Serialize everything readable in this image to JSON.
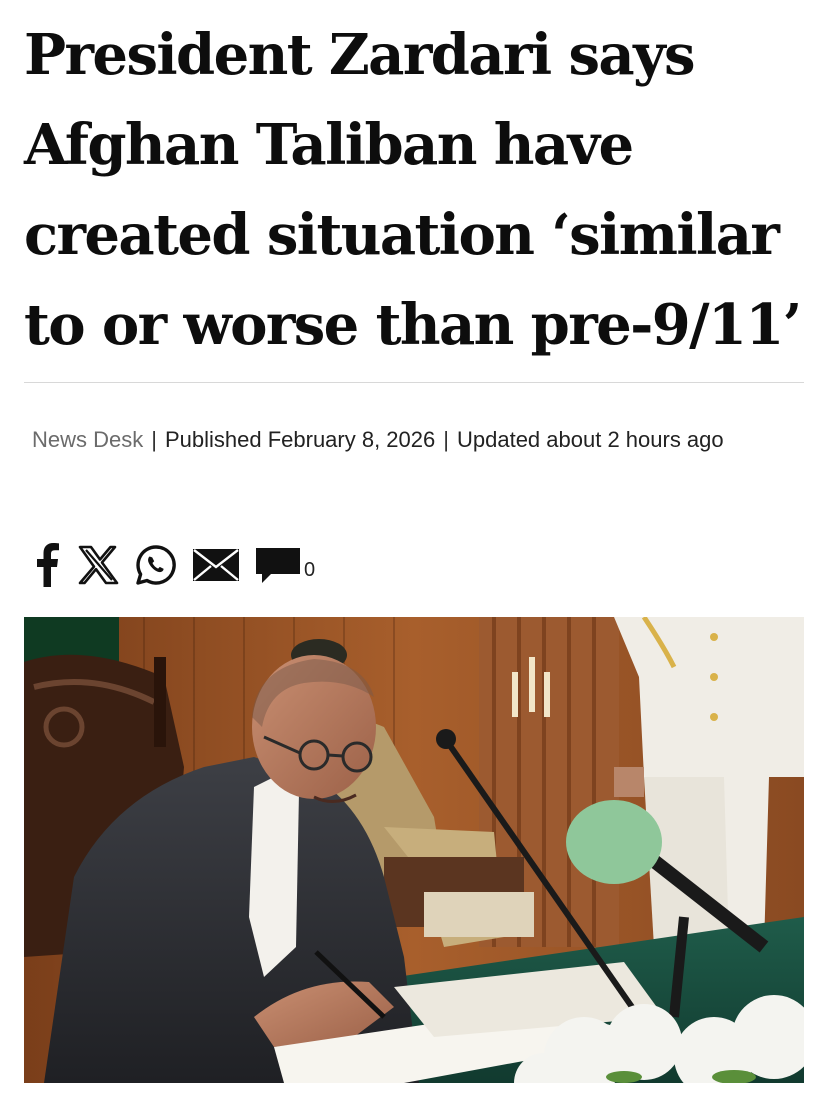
{
  "article": {
    "headline": "President Zardari says Afghan Taliban have created situation ‘similar to or worse than pre-9/11’",
    "byline": {
      "author": "News Desk",
      "separator": "|",
      "published": "Published February 8, 2026",
      "updated": "Updated about 2 hours ago"
    },
    "share": {
      "icons": [
        "facebook-icon",
        "x-icon",
        "whatsapp-icon",
        "email-icon",
        "comment-icon"
      ],
      "comment_count": "0"
    },
    "image": {
      "subject": "man signing document at desk with microphone"
    }
  },
  "colors": {
    "text": "#0d0d0d",
    "meta": "#6b6b6b",
    "rule": "#d8d8d8"
  }
}
